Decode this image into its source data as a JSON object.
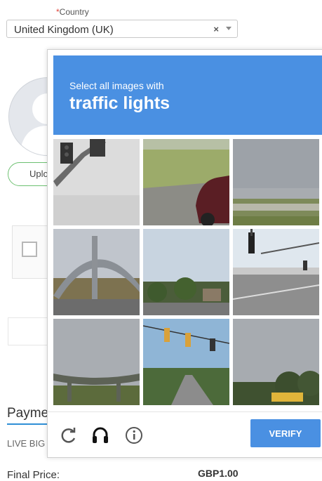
{
  "form": {
    "country_required_mark": "*",
    "country_label": "Country",
    "country_value": "United Kingdom (UK)",
    "clear_glyph": "×",
    "upload_label": "Uplo",
    "payment_title": "Payme",
    "live_label": "LIVE BIG",
    "final_price_label": "Final Price:",
    "final_price_value": "GBP1.00"
  },
  "captcha": {
    "prompt": "Select all images with",
    "target": "traffic lights",
    "verify_label": "VERIFY",
    "accent_color": "#4a90e2",
    "icons": [
      "reload-icon",
      "audio-icon",
      "info-icon"
    ],
    "tiles": [
      "traffic-light-on-pole",
      "car-grass-field",
      "cloudy-field",
      "bridge-arch",
      "trees-road",
      "intersection-traffic-light",
      "overpass-cloudy",
      "road-with-traffic-lights",
      "trees-bus"
    ]
  }
}
